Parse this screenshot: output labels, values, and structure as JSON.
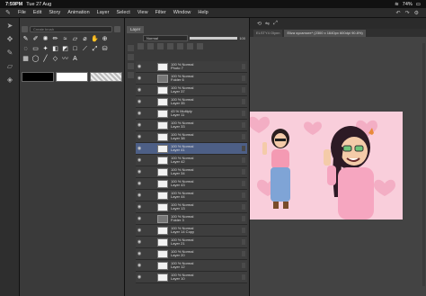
{
  "status": {
    "time": "7:59PM",
    "date": "Tue 27 Aug",
    "battery": "74%"
  },
  "menu": {
    "items": [
      "File",
      "Edit",
      "Story",
      "Animation",
      "Layer",
      "Select",
      "View",
      "Filter",
      "Window",
      "Help"
    ]
  },
  "tool_panel": {
    "search_placeholder": "Create brush",
    "swatch_colors": [
      "#000000",
      "#ffffff",
      "checker"
    ]
  },
  "layer_panel": {
    "tab_label": "Layer",
    "blend_mode": "Normal",
    "opacity_value": "100",
    "layers": [
      {
        "mode": "100 % Normal",
        "name": "Photo 7",
        "type": "layer",
        "selected": false
      },
      {
        "mode": "100 % Normal",
        "name": "Folder 6",
        "type": "folder",
        "selected": false
      },
      {
        "mode": "100 % Normal",
        "name": "Layer 37",
        "type": "layer",
        "selected": false
      },
      {
        "mode": "100 % Normal",
        "name": "Layer 35",
        "type": "layer",
        "selected": false
      },
      {
        "mode": "43 % Multiply",
        "name": "Layer 11",
        "type": "layer",
        "selected": false
      },
      {
        "mode": "100 % Normal",
        "name": "Layer 33",
        "type": "layer",
        "selected": false
      },
      {
        "mode": "100 % Normal",
        "name": "Layer 38",
        "type": "layer",
        "selected": false
      },
      {
        "mode": "100 % Normal",
        "name": "Layer 41",
        "type": "layer",
        "selected": true
      },
      {
        "mode": "100 % Normal",
        "name": "Layer 42",
        "type": "layer",
        "selected": false
      },
      {
        "mode": "100 % Normal",
        "name": "Layer 34",
        "type": "layer",
        "selected": false
      },
      {
        "mode": "100 % Normal",
        "name": "Layer 43",
        "type": "layer",
        "selected": false
      },
      {
        "mode": "100 % Normal",
        "name": "Layer 44",
        "type": "layer",
        "selected": false
      },
      {
        "mode": "100 % Normal",
        "name": "Layer 13",
        "type": "layer",
        "selected": false
      },
      {
        "mode": "100 % Normal",
        "name": "Folder 3",
        "type": "folder",
        "selected": false
      },
      {
        "mode": "100 % Normal",
        "name": "Layer 14 Copy",
        "type": "layer",
        "selected": false
      },
      {
        "mode": "100 % Normal",
        "name": "Layer 21",
        "type": "layer",
        "selected": false
      },
      {
        "mode": "100 % Normal",
        "name": "Layer 20",
        "type": "layer",
        "selected": false
      },
      {
        "mode": "100 % Normal",
        "name": "Layer 12",
        "type": "layer",
        "selected": false
      },
      {
        "mode": "100 % Normal",
        "name": "Layer 10",
        "type": "layer",
        "selected": false
      }
    ]
  },
  "canvas": {
    "tabs": [
      "ELSTY4 Olynn",
      "Eliza sycamore* (2300 x 1640px 600dpi 90.8%)"
    ]
  },
  "colors": {
    "selected_layer": "#4d5f86",
    "artwork_bg": "#f7c8d6"
  }
}
